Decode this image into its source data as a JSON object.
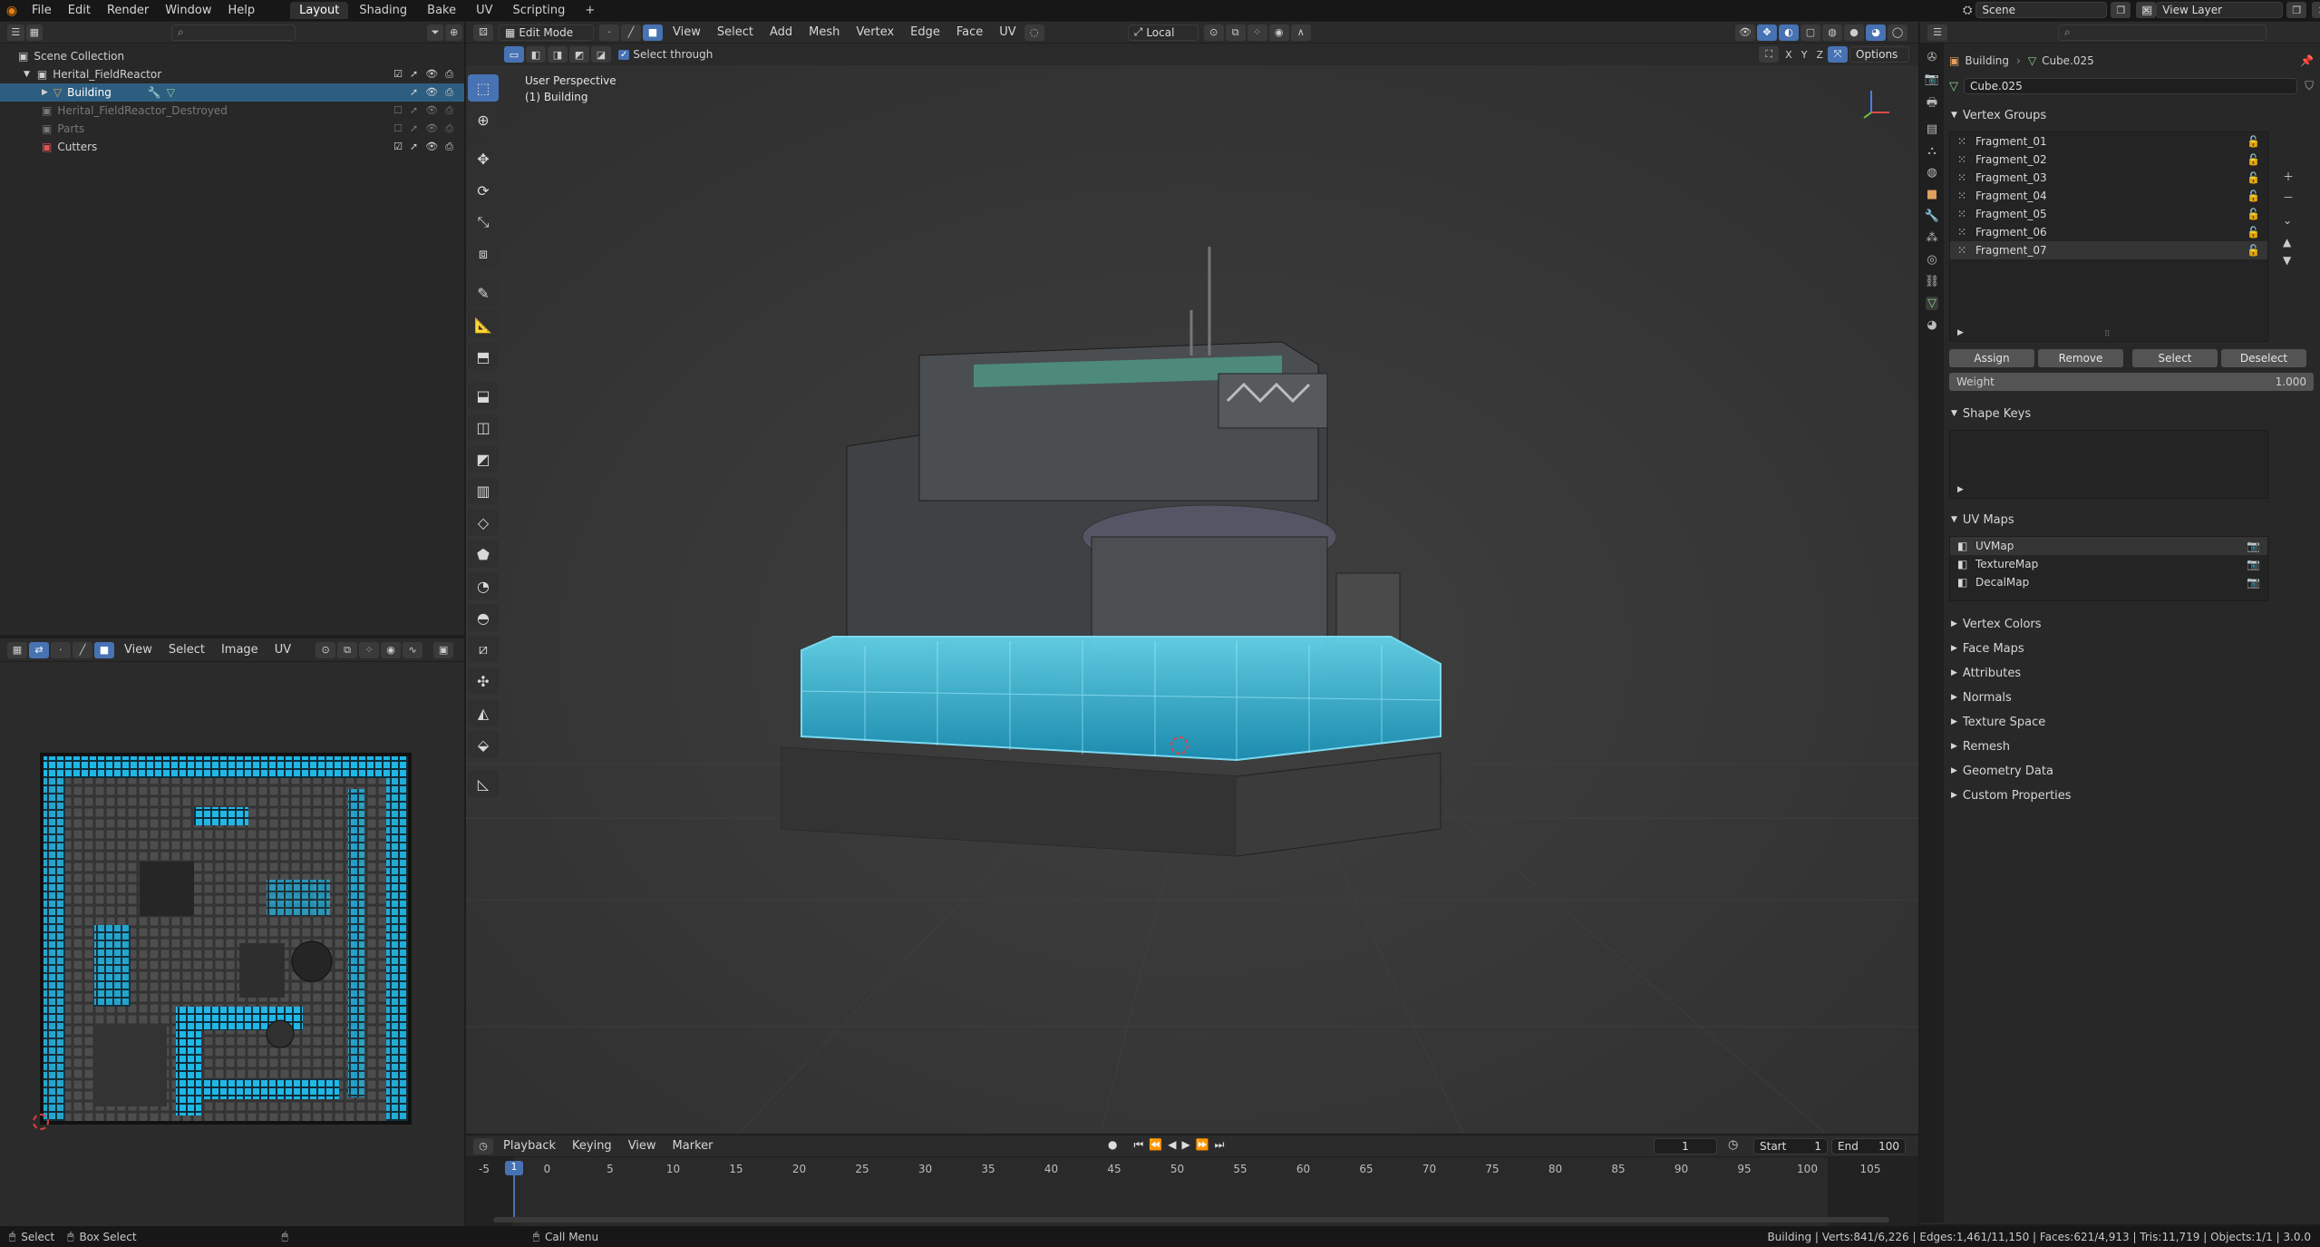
{
  "topbar": {
    "menus": [
      "File",
      "Edit",
      "Render",
      "Window",
      "Help"
    ],
    "workspaces": [
      "Layout",
      "Shading",
      "Bake",
      "UV",
      "Scripting",
      "+"
    ],
    "active_workspace": "Layout",
    "scene": "Scene",
    "view_layer": "View Layer"
  },
  "outliner": {
    "root": "Scene Collection",
    "items": [
      {
        "label": "Herital_FieldReactor",
        "selected": false,
        "dim": false
      },
      {
        "label": "Building",
        "selected": true,
        "dim": false
      },
      {
        "label": "Herital_FieldReactor_Destroyed",
        "selected": false,
        "dim": true
      },
      {
        "label": "Parts",
        "selected": false,
        "dim": true
      },
      {
        "label": "Cutters",
        "selected": false,
        "dim": false
      }
    ]
  },
  "uv_editor": {
    "menus": [
      "View",
      "Select",
      "Image",
      "UV"
    ]
  },
  "viewport": {
    "mode": "Edit Mode",
    "menus": [
      "View",
      "Select",
      "Add",
      "Mesh",
      "Vertex",
      "Edge",
      "Face",
      "UV"
    ],
    "transform_orientation": "Local",
    "select_through": "Select through",
    "perspective_label": "User Perspective",
    "object_label": "(1) Building",
    "options": "Options",
    "axes": [
      "X",
      "Y",
      "Z"
    ]
  },
  "properties": {
    "breadcrumb_object": "Building",
    "breadcrumb_mesh": "Cube.025",
    "mesh_name": "Cube.025",
    "vertex_groups_title": "Vertex Groups",
    "vertex_groups": [
      "Fragment_01",
      "Fragment_02",
      "Fragment_03",
      "Fragment_04",
      "Fragment_05",
      "Fragment_06",
      "Fragment_07"
    ],
    "buttons": {
      "assign": "Assign",
      "remove": "Remove",
      "select": "Select",
      "deselect": "Deselect"
    },
    "weight_label": "Weight",
    "weight_value": "1.000",
    "shape_keys_title": "Shape Keys",
    "uv_maps_title": "UV Maps",
    "uv_maps": [
      "UVMap",
      "TextureMap",
      "DecalMap"
    ],
    "collapsed_sections": [
      "Vertex Colors",
      "Face Maps",
      "Attributes",
      "Normals",
      "Texture Space",
      "Remesh",
      "Geometry Data",
      "Custom Properties"
    ]
  },
  "timeline": {
    "menus": [
      "Playback",
      "Keying",
      "View",
      "Marker"
    ],
    "current_frame": "1",
    "start_label": "Start",
    "start": "1",
    "end_label": "End",
    "end": "100",
    "ticks": [
      "-5",
      "0",
      "5",
      "10",
      "15",
      "20",
      "25",
      "30",
      "35",
      "40",
      "45",
      "50",
      "55",
      "60",
      "65",
      "70",
      "75",
      "80",
      "85",
      "90",
      "95",
      "100",
      "105"
    ],
    "playhead_label": "1"
  },
  "statusbar": {
    "select": "Select",
    "box_select": "Box Select",
    "call_menu": "Call Menu",
    "stats": "Building | Verts:841/6,226 | Edges:1,461/11,150 | Faces:621/4,913 | Tris:11,719 | Objects:1/1 | 3.0.0"
  },
  "colors": {
    "accent": "#4772b3",
    "selection": "#2d5e80",
    "mesh_highlight": "#39b6e0"
  }
}
